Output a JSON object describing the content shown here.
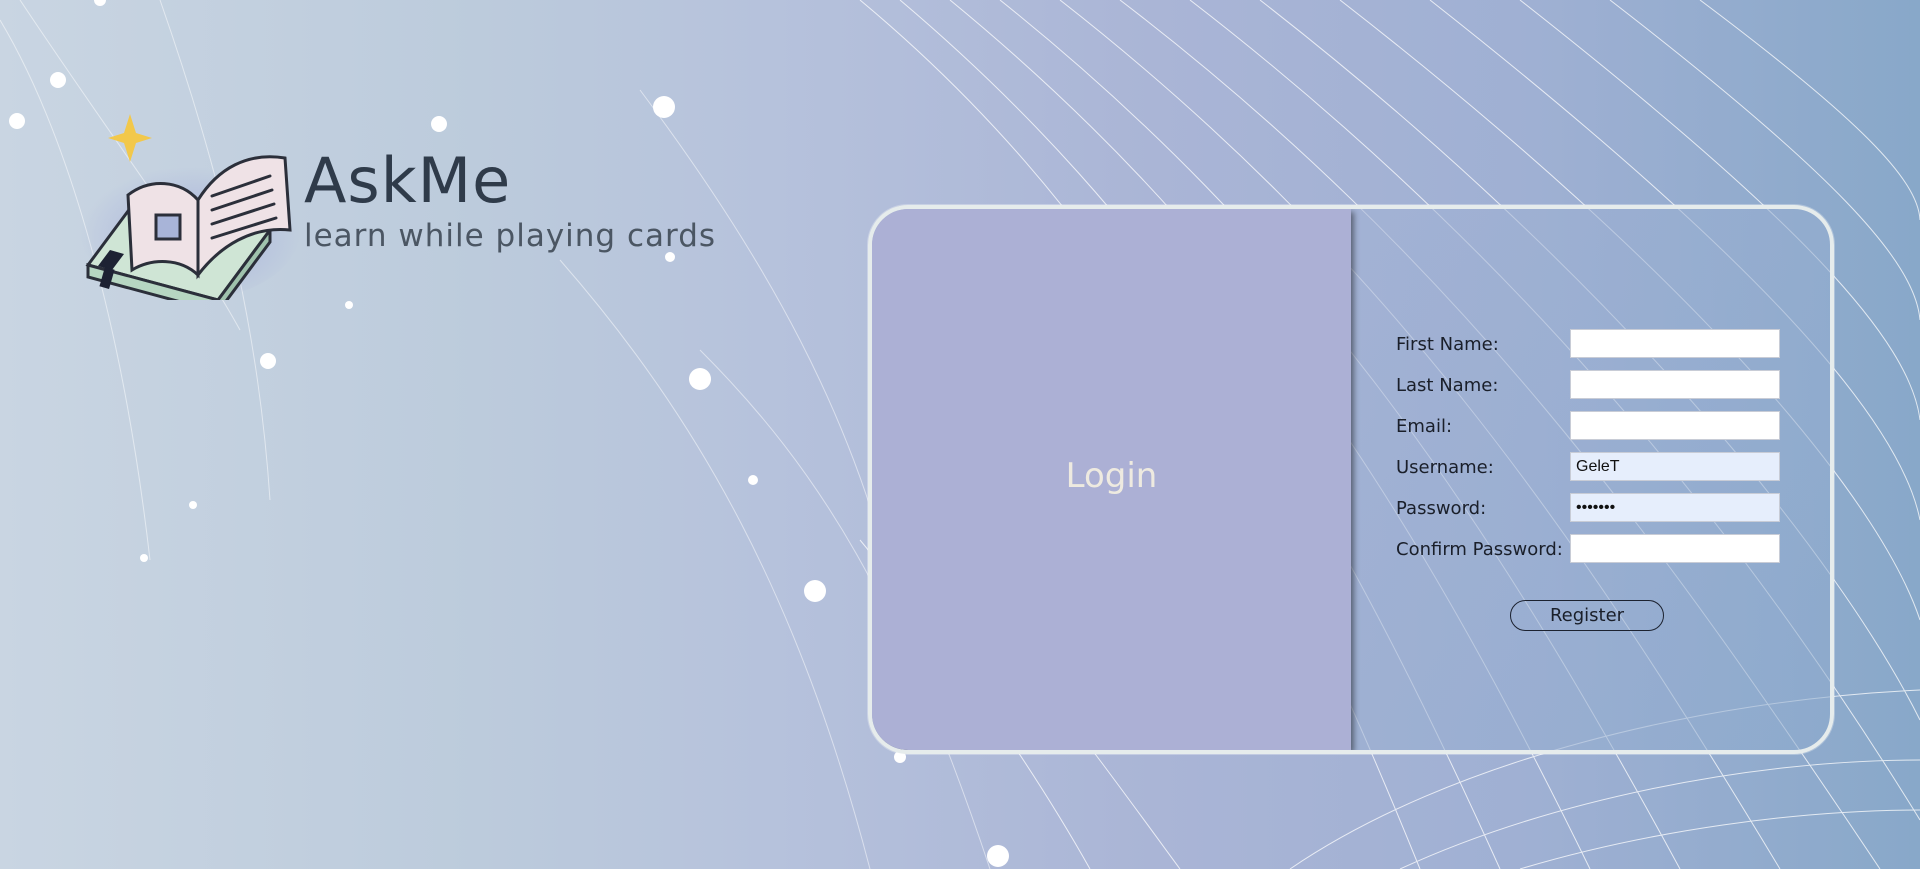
{
  "brand": {
    "title": "AskMe",
    "tagline": "learn while playing cards",
    "logo_icon": "open-book-icon",
    "star_icon": "sparkle-star-icon"
  },
  "login_panel": {
    "label": "Login"
  },
  "register_form": {
    "fields": [
      {
        "label": "First Name:",
        "value": "",
        "type": "text"
      },
      {
        "label": "Last Name:",
        "value": "",
        "type": "text"
      },
      {
        "label": "Email:",
        "value": "",
        "type": "email"
      },
      {
        "label": "Username:",
        "value": "GeleT",
        "type": "text"
      },
      {
        "label": "Password:",
        "value": "•••••••",
        "type": "password"
      },
      {
        "label": "Confirm Password:",
        "value": "",
        "type": "password"
      }
    ],
    "submit_label": "Register"
  },
  "colors": {
    "login_panel_bg": "#acb0d5",
    "card_border": "#e6ecec",
    "star": "#f2c84b",
    "autofill_bg": "#e6eefc"
  }
}
